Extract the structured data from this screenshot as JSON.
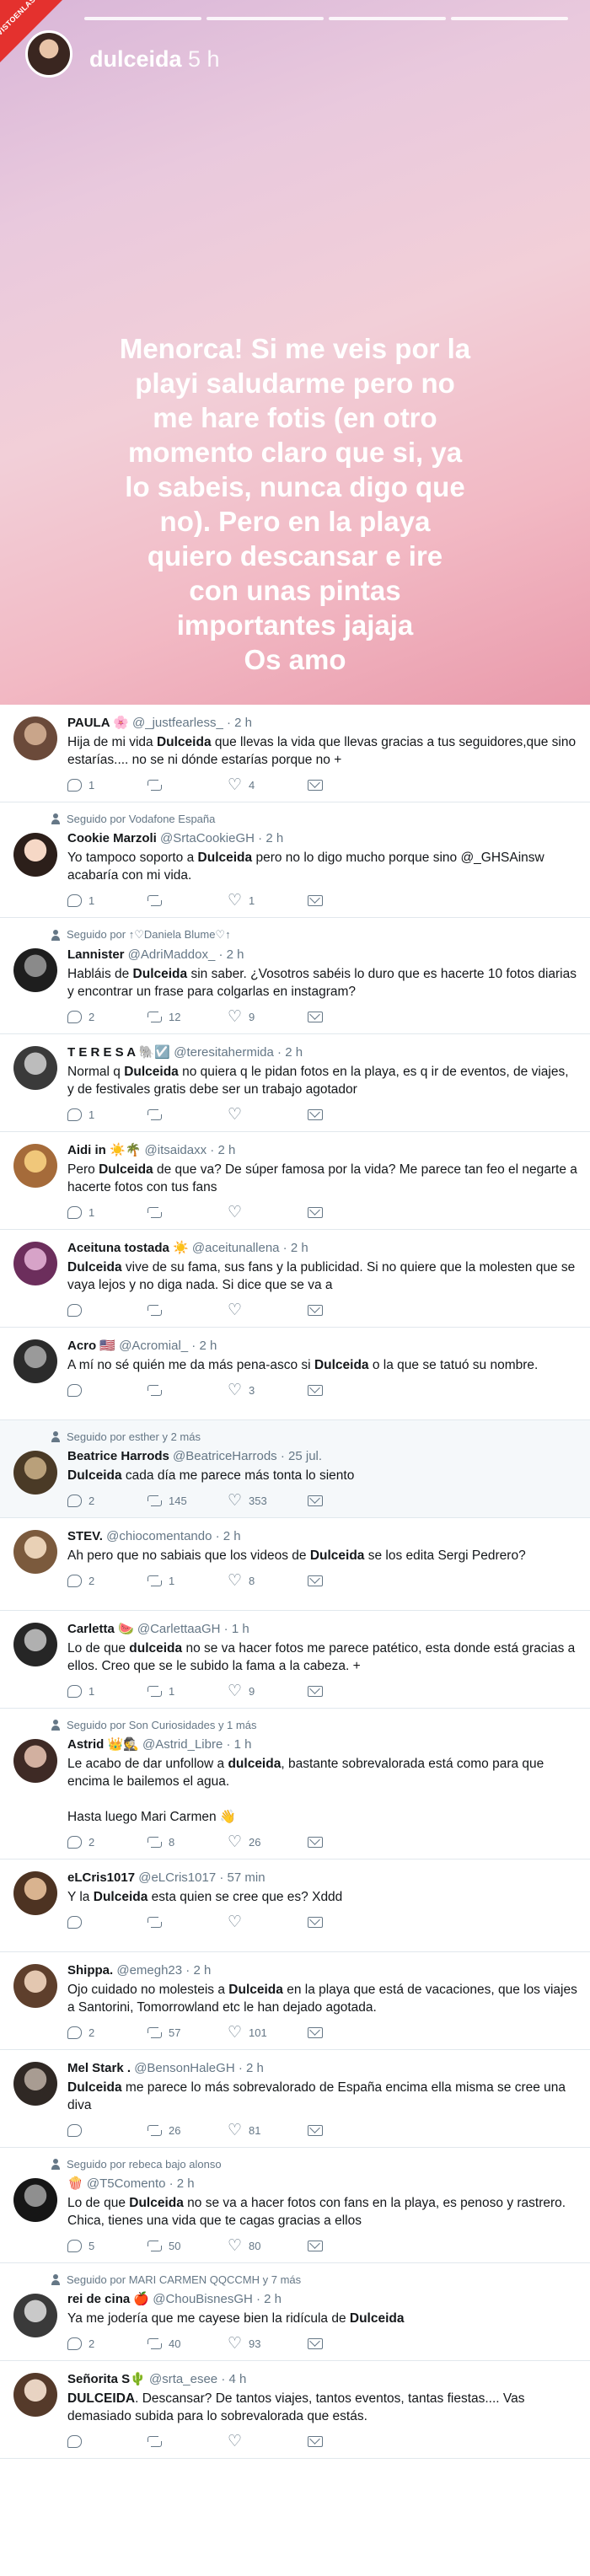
{
  "story": {
    "watermark": "VISTOENLASREDES",
    "username": "dulceida",
    "age": "5 h",
    "caption": "Menorca! Si me veis por la\nplayi saludarme pero no\nme hare fotis (en otro\nmomento claro que si, ya\nlo sabeis, nunca digo que\nno). Pero en la playa\nquiero descansar e ire\ncon unas pintas\nimportantes jajaja\nOs amo"
  },
  "tweets": [
    {
      "name": "PAULA 🌸",
      "handle": "@_justfearless_",
      "time": "2 h",
      "text": "Hija de mi vida **Dulceida** que llevas la vida que llevas gracias a tus seguidores,que sino estarías.... no se ni dónde estarías porque no +",
      "replies": "1",
      "retweets": "",
      "likes": "4",
      "avatar": [
        "#c9a58a",
        "#6b4a3a"
      ]
    },
    {
      "social": "Seguido por Vodafone España",
      "name": "Cookie Marzoli",
      "handle": "@SrtaCookieGH",
      "time": "2 h",
      "text": "Yo tampoco soporto a **Dulceida** pero no lo digo mucho porque sino @_GHSAinsw acabaría con mi vida.",
      "replies": "1",
      "retweets": "",
      "likes": "1",
      "avatar": [
        "#f6d8c6",
        "#2c1f1a"
      ]
    },
    {
      "social": "Seguido por ↑♡Daniela Blume♡↑",
      "name": "Lannister",
      "handle": "@AdriMaddox_",
      "time": "2 h",
      "text": "Habláis de **Dulceida** sin saber. ¿Vosotros sabéis lo duro que es hacerte 10 fotos diarias y encontrar un frase para colgarlas en instagram?",
      "replies": "2",
      "retweets": "12",
      "likes": "9",
      "avatar": [
        "#8a8a8a",
        "#1e1e1e"
      ]
    },
    {
      "name": "T E R E S A 🐘☑️",
      "handle": "@teresitahermida",
      "time": "2 h",
      "text": "Normal q **Dulceida** no quiera q le pidan fotos en la playa, es q ir de eventos, de viajes, y de festivales gratis debe ser un trabajo agotador",
      "replies": "1",
      "retweets": "",
      "likes": "",
      "avatar": [
        "#bcbcbc",
        "#3a3a3a"
      ]
    },
    {
      "name": "Aidi in ☀️🌴",
      "handle": "@itsaidaxx",
      "time": "2 h",
      "text": "Pero **Dulceida** de que va? De súper famosa por la vida? Me parece tan feo el negarte a hacerte fotos con tus fans",
      "replies": "1",
      "retweets": "",
      "likes": "",
      "avatar": [
        "#f0c77a",
        "#a56b3a"
      ]
    },
    {
      "name": "Aceituna tostada ☀️",
      "handle": "@aceitunallena",
      "time": "2 h",
      "text": "**Dulceida** vive de su fama, sus fans y la publicidad. Si no quiere que la molesten que se vaya lejos y no diga nada. Si dice que se va a",
      "replies": "",
      "retweets": "",
      "likes": "",
      "avatar": [
        "#d7a3c8",
        "#6c2e5c"
      ]
    },
    {
      "name": "Acro 🇺🇸",
      "handle": "@Acromial_",
      "time": "2 h",
      "text": "A mí no sé quién me da más pena-asco si **Dulceida** o la que se tatuó su nombre.",
      "replies": "",
      "retweets": "",
      "likes": "3",
      "avatar": [
        "#9a9a9a",
        "#2b2b2b"
      ]
    },
    {
      "social": "Seguido por esther y 2 más",
      "highlight": true,
      "name": "Beatrice Harrods",
      "handle": "@BeatriceHarrods",
      "time": "25 jul.",
      "text": "**Dulceida** cada día me parece más tonta lo siento",
      "replies": "2",
      "retweets": "145",
      "likes": "353",
      "avatar": [
        "#b9a07a",
        "#4a3a26"
      ]
    },
    {
      "name": "STEV.",
      "handle": "@chiocomentando",
      "time": "2 h",
      "text": "Ah pero que no sabiais que los videos de **Dulceida** se los edita Sergi Pedrero?",
      "replies": "2",
      "retweets": "1",
      "likes": "8",
      "avatar": [
        "#e9d1b6",
        "#7b5a3d"
      ]
    },
    {
      "name": "Carletta 🍉",
      "handle": "@CarlettaaGH",
      "time": "1 h",
      "text": "Lo de que **dulceida** no se va hacer fotos me parece patético, esta donde está gracias a ellos. Creo que se le subido la fama a la cabeza. +",
      "replies": "1",
      "retweets": "1",
      "likes": "9",
      "avatar": [
        "#b0b0b0",
        "#262626"
      ]
    },
    {
      "social": "Seguido por Son Curiosidades y 1 más",
      "name": "Astrid 👑🕵",
      "handle": "@Astrid_Libre",
      "time": "1 h",
      "text": "Le acabo de dar unfollow a **dulceida**, bastante sobrevalorada está como para que encima le bailemos el agua.\n\nHasta luego Mari Carmen 👋",
      "replies": "2",
      "retweets": "8",
      "likes": "26",
      "avatar": [
        "#d2b0a0",
        "#3e2a25"
      ]
    },
    {
      "name": "eLCris1017",
      "handle": "@eLCris1017",
      "time": "57 min",
      "text": "Y la **Dulceida** esta quien se cree que es? Xddd",
      "replies": "",
      "retweets": "",
      "likes": "",
      "avatar": [
        "#d9b38f",
        "#4d3322"
      ]
    },
    {
      "name": "Shippa.",
      "handle": "@emegh23",
      "time": "2 h",
      "text": "Ojo cuidado no molesteis a **Dulceida** en la playa que está de vacaciones, que los viajes a Santorini, Tomorrowland etc le han dejado agotada.",
      "replies": "2",
      "retweets": "57",
      "likes": "101",
      "avatar": [
        "#e3c7b0",
        "#5e3f2c"
      ]
    },
    {
      "name": "Mel Stark .",
      "handle": "@BensonHaleGH",
      "time": "2 h",
      "text": "**Dulceida** me parece lo más sobrevalorado de España encima ella misma se cree una diva",
      "replies": "",
      "retweets": "26",
      "likes": "81",
      "avatar": [
        "#a89c92",
        "#2f2824"
      ]
    },
    {
      "social": "Seguido por rebeca bajo alonso",
      "name": "🍿",
      "handle": "@T5Comento",
      "time": "2 h",
      "text": "Lo de que **Dulceida** no se va a hacer fotos con fans en la playa, es penoso y rastrero. Chica, tienes una vida que te cagas gracias a ellos",
      "replies": "5",
      "retweets": "50",
      "likes": "80",
      "avatar": [
        "#8f8f8f",
        "#161616"
      ]
    },
    {
      "social": "Seguido por MARI CARMEN QQCCMH y 7 más",
      "name": "rei de cina 🍎",
      "handle": "@ChouBisnesGH",
      "time": "2 h",
      "text": "Ya me jodería que me cayese bien la ridícula de **Dulceida**",
      "replies": "2",
      "retweets": "40",
      "likes": "93",
      "avatar": [
        "#c9c9c9",
        "#3a3a3a"
      ]
    },
    {
      "name": "Señorita S🌵",
      "handle": "@srta_esee",
      "time": "4 h",
      "text": "**DULCEIDA**. Descansar? De tantos viajes, tantos eventos, tantas fiestas.... Vas demasiado subida para lo sobrevalorada que estás.",
      "replies": "",
      "retweets": "",
      "likes": "",
      "avatar": [
        "#e8d3c2",
        "#553a2a"
      ]
    }
  ]
}
